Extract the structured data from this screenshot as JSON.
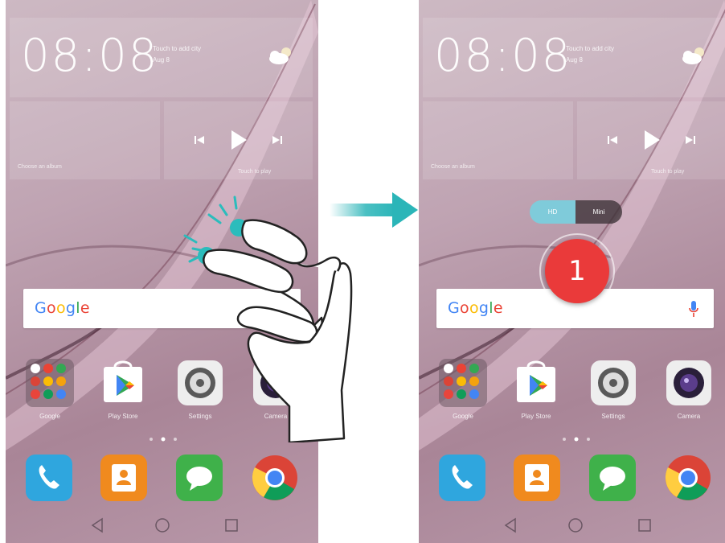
{
  "clock": {
    "time": "08:08",
    "city_prompt": "Touch to add city",
    "date": "Aug 8",
    "weather_icon": "cloud-sun-icon"
  },
  "music": {
    "album_prompt": "Choose an album",
    "track_label": "Touch to play"
  },
  "search": {
    "logo": [
      "G",
      "o",
      "o",
      "g",
      "l",
      "e"
    ],
    "logo_colors": [
      "#4285F4",
      "#EA4335",
      "#FBBC05",
      "#4285F4",
      "#34A853",
      "#EA4335"
    ],
    "mic_icon": "mic-icon",
    "mic_color": "#4285F4"
  },
  "apps": [
    {
      "label": "Google",
      "icon": "google-folder-icon"
    },
    {
      "label": "Play Store",
      "icon": "play-store-icon"
    },
    {
      "label": "Settings",
      "icon": "settings-icon"
    },
    {
      "label": "Camera",
      "icon": "camera-icon"
    }
  ],
  "dock": [
    {
      "name": "phone",
      "icon": "phone-icon",
      "color": "#2fa6de"
    },
    {
      "name": "contacts",
      "icon": "contacts-icon",
      "color": "#f08a1e"
    },
    {
      "name": "messages",
      "icon": "messages-icon",
      "color": "#3fb14a"
    },
    {
      "name": "chrome",
      "icon": "chrome-icon",
      "color": "#db4437"
    }
  ],
  "nav": {
    "back_icon": "back-triangle-icon",
    "home_icon": "home-circle-icon",
    "recents_icon": "recents-square-icon"
  },
  "one_hand_mode": {
    "hd_label": "HD",
    "mini_label": "Mini",
    "active": "HD",
    "hd_color": "#7bcddc"
  },
  "badge": {
    "value": "1",
    "color": "#ea3a3a"
  },
  "gesture": {
    "icon": "knuckle-double-tap-hand-icon",
    "tap_color": "#2bbcbc"
  },
  "arrow": {
    "icon": "right-arrow-icon",
    "color": "#2bb5b8"
  }
}
